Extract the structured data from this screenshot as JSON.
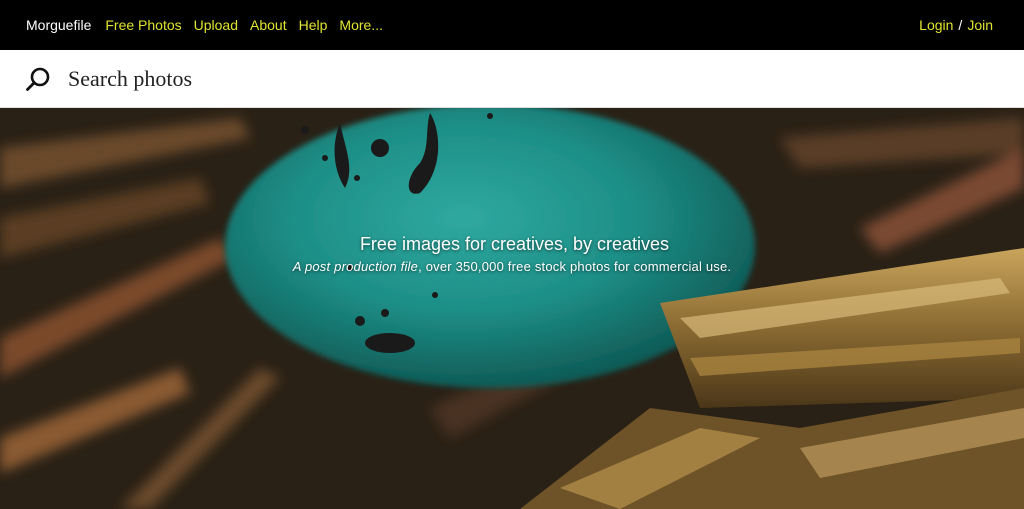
{
  "nav": {
    "brand": "Morguefile",
    "links": [
      "Free Photos",
      "Upload",
      "About",
      "Help",
      "More..."
    ]
  },
  "auth": {
    "login": "Login",
    "separator": "/",
    "join": "Join"
  },
  "search": {
    "placeholder": "Search photos",
    "icon": "search-icon"
  },
  "hero": {
    "title": "Free images for creatives, by creatives",
    "subtitle_emphasis": "A post production file",
    "subtitle_rest": ", over 350,000 free stock photos for commercial use."
  },
  "colors": {
    "link": "#e0e332",
    "brand": "#ffffff",
    "topbar_bg": "#000000"
  }
}
